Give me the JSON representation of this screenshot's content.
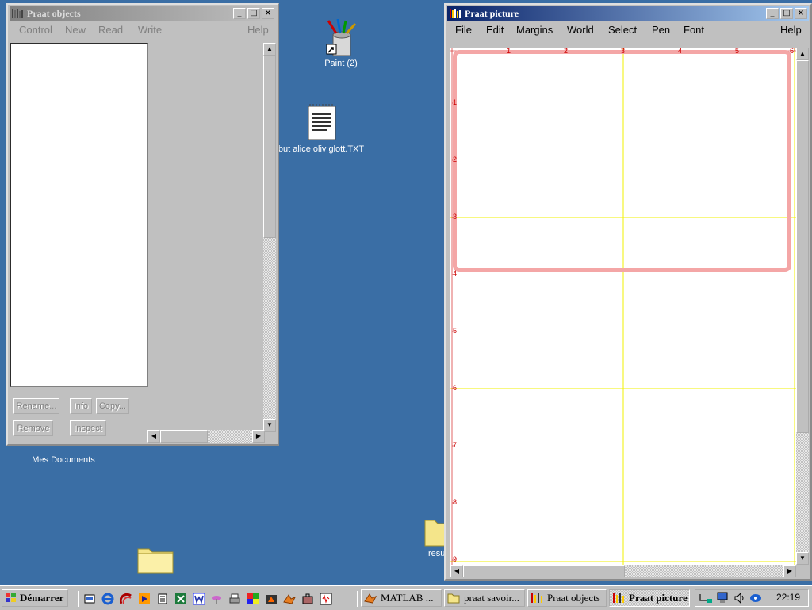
{
  "desktop": {
    "icons": {
      "paint": "Paint (2)",
      "txt": "but alice oliv glott.TXT",
      "mydocs": "Mes Documents",
      "resu": "resu"
    }
  },
  "praat_objects": {
    "title": "Praat objects",
    "menu": [
      "Control",
      "New",
      "Read",
      "Write",
      "Help"
    ],
    "buttons": {
      "rename": "Rename...",
      "info": "Info",
      "copy": "Copy...",
      "remove": "Remove",
      "inspect": "Inspect"
    }
  },
  "praat_picture": {
    "title": "Praat picture",
    "menu": [
      "File",
      "Edit",
      "Margins",
      "World",
      "Select",
      "Pen",
      "Font",
      "Help"
    ],
    "ruler_top": [
      "1",
      "2",
      "3",
      "4",
      "5",
      "6"
    ],
    "ruler_left": [
      "1",
      "2",
      "3",
      "4",
      "5",
      "6",
      "7",
      "8",
      "9"
    ]
  },
  "taskbar": {
    "start": "Démarrer",
    "tasks": [
      "MATLAB ...",
      "praat savoir...",
      "Praat objects",
      "Praat picture"
    ],
    "clock": "22:19"
  },
  "colors": {
    "desktop": "#3a6ea5",
    "selection_rect": "#f4a6a6",
    "grid_lines": "#f0f000",
    "ruler_text": "#cc0000"
  }
}
